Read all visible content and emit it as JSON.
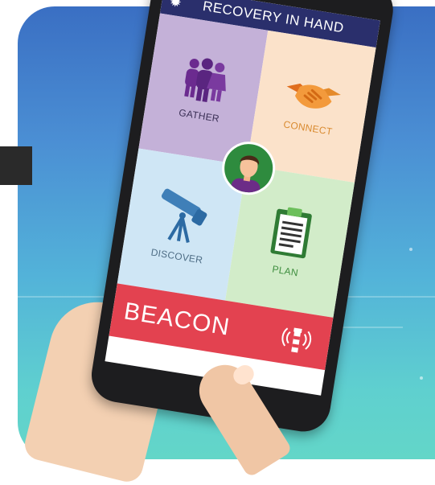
{
  "app": {
    "title": "RECOVERY IN HAND"
  },
  "tiles": [
    {
      "label": "GATHER",
      "icon": "people-group-icon"
    },
    {
      "label": "CONNECT",
      "icon": "handshake-icon"
    },
    {
      "label": "DISCOVER",
      "icon": "telescope-icon"
    },
    {
      "label": "PLAN",
      "icon": "clipboard-icon"
    }
  ],
  "beacon": {
    "label": "BEACON",
    "icon": "lighthouse-icon"
  },
  "header": {
    "settings_icon": "gear-icon"
  },
  "colors": {
    "header": "#2a2f6c",
    "gather": "#c4b1d8",
    "connect": "#fbe2ca",
    "discover": "#cfe6f5",
    "plan": "#d2ecc9",
    "beacon": "#e34250",
    "avatar_bg": "#2e8b3e"
  }
}
